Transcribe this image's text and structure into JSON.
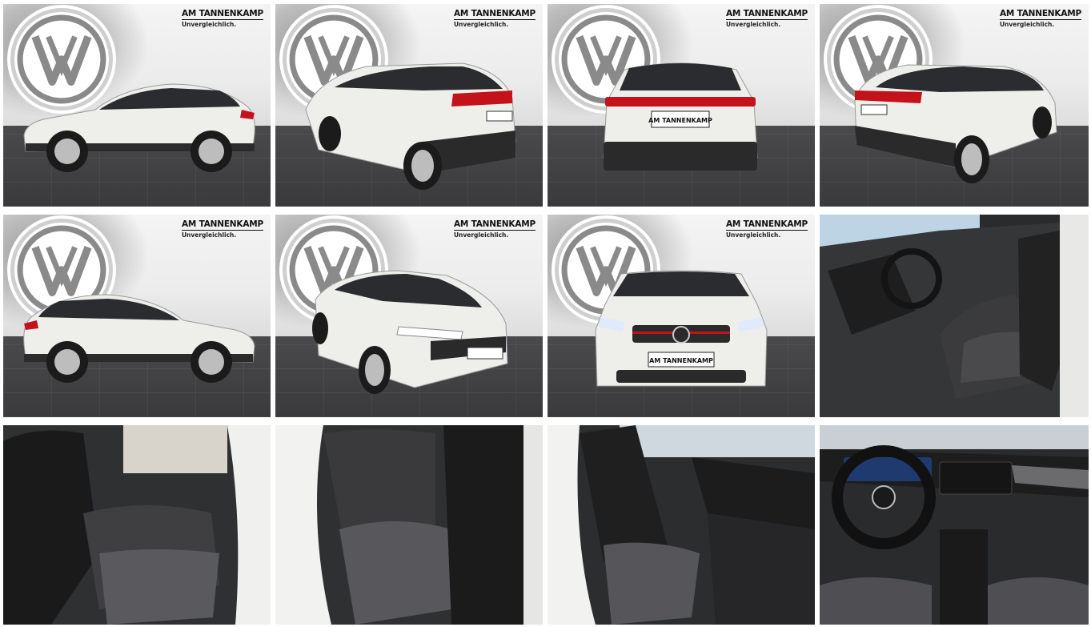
{
  "gallery": {
    "dealer_name": "AM TANNENKAMP",
    "dealer_claim": "Unvergleichlich.",
    "plate_text": "AM TANNENKAMP",
    "colors": {
      "car_white": "#eeeeea",
      "taillight": "#c4121b",
      "floor": "#3f3f41",
      "interior_dark": "#1e1e1f"
    },
    "photos": [
      {
        "view": "side-left",
        "kind": "exterior"
      },
      {
        "view": "rear-three-quarter-left",
        "kind": "exterior"
      },
      {
        "view": "rear",
        "kind": "exterior"
      },
      {
        "view": "rear-three-quarter-right",
        "kind": "exterior"
      },
      {
        "view": "side-right",
        "kind": "exterior"
      },
      {
        "view": "front-three-quarter-left",
        "kind": "exterior"
      },
      {
        "view": "front",
        "kind": "exterior"
      },
      {
        "view": "front-seats",
        "kind": "interior"
      },
      {
        "view": "rear-seats-left",
        "kind": "interior"
      },
      {
        "view": "rear-seats-right",
        "kind": "interior"
      },
      {
        "view": "passenger-seat",
        "kind": "interior"
      },
      {
        "view": "cockpit",
        "kind": "interior"
      }
    ]
  }
}
